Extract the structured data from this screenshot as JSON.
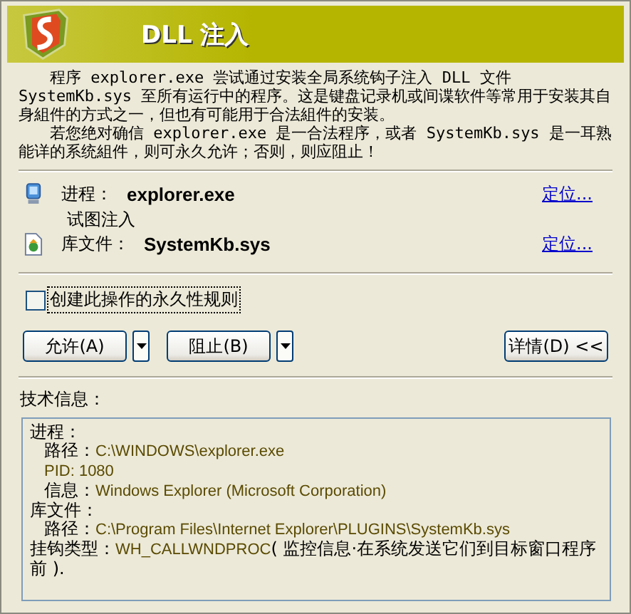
{
  "window": {
    "title": "DLL 注入"
  },
  "description": [
    "程序 explorer.exe 尝试通过安装全局系统钩子注入 DLL 文件 SystemKb.sys 至所有运行中的程序。这是键盘记录机或间谍软件等常用于安装其自身組件的方式之一，但也有可能用于合法組件的安装。",
    "若您绝对确信 explorer.exe 是一合法程序，或者 SystemKb.sys 是一耳熟能详的系统組件，则可永久允许；否则，则应阻止！"
  ],
  "subjects": [
    {
      "kind": "process",
      "label": "进程：",
      "value": "explorer.exe",
      "link": "定位...",
      "note": "试图注入"
    },
    {
      "kind": "file",
      "label": "库文件：",
      "value": "SystemKb.sys",
      "link": "定位..."
    }
  ],
  "rule_checkbox": {
    "label": "创建此操作的永久性规则",
    "checked": false
  },
  "buttons": [
    {
      "label": "允许(A)",
      "dropdown": true
    },
    {
      "label": "阻止(B)",
      "dropdown": true
    }
  ],
  "details_button": {
    "label": "详情(D) <<"
  },
  "tech_info": {
    "title": "技术信息：",
    "items": [
      {
        "label": "进程：",
        "children": [
          {
            "label": "路径：",
            "value": "C:\\WINDOWS\\explorer.exe"
          },
          {
            "value": "PID: 1080"
          },
          {
            "label": "信息：",
            "value": "Windows Explorer (Microsoft Corporation)"
          }
        ]
      },
      {
        "label": "库文件：",
        "children": [
          {
            "label": "路径：",
            "value": "C:\\Program Files\\Internet Explorer\\PLUGINS\\SystemKb.sys"
          }
        ]
      },
      {
        "label": "挂钩类型：",
        "value": "WH_CALLWNDPROC",
        "note": "( 监控信息·在系统发送它们到目标窗口程序前 )."
      }
    ]
  }
}
